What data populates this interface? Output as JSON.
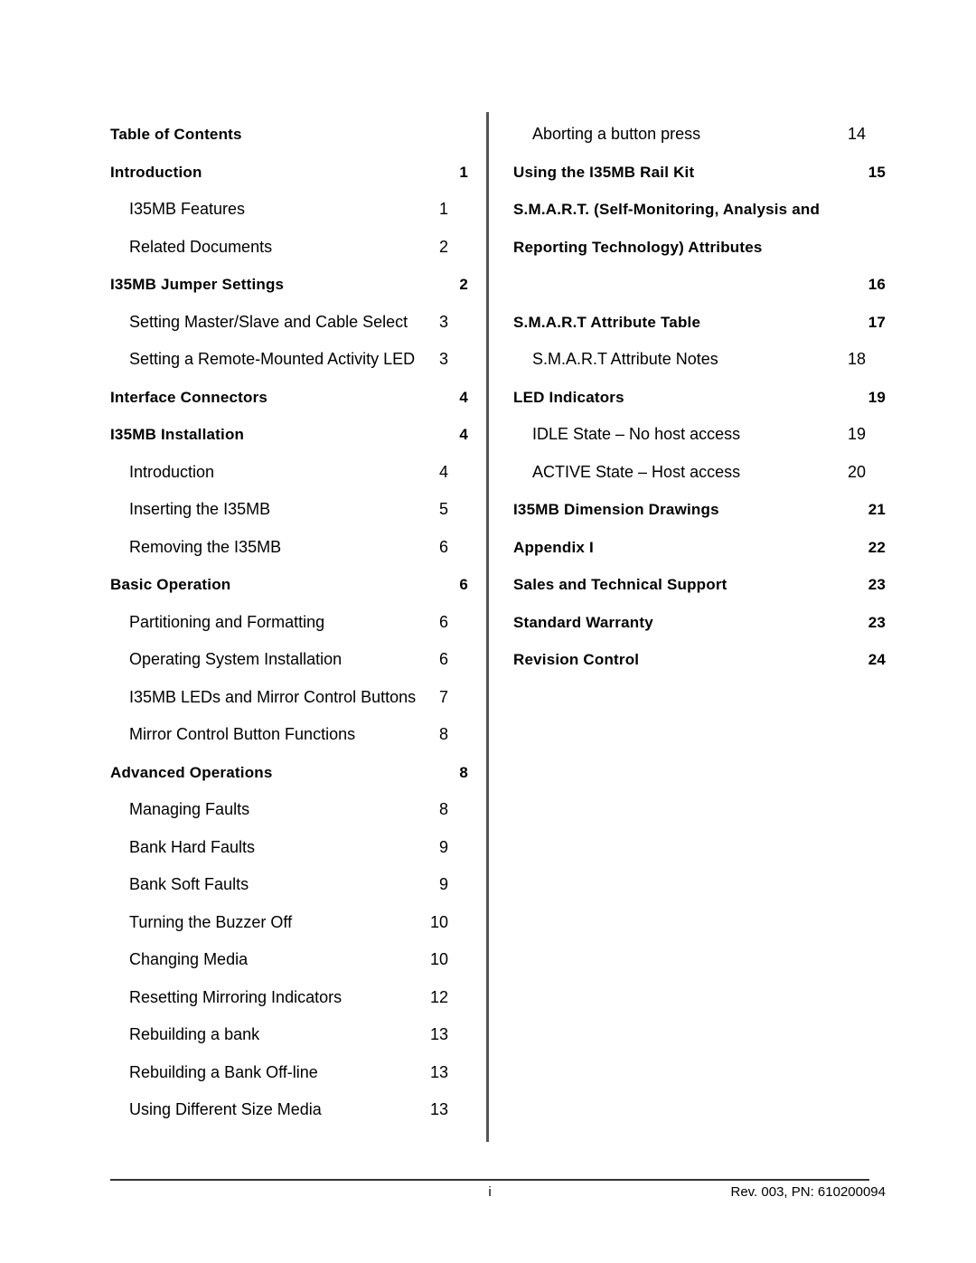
{
  "document": {
    "toc_title": "Table of Contents"
  },
  "left_column": {
    "entries": [
      {
        "label": "Introduction",
        "page": "1",
        "level": 1
      },
      {
        "label": "I35MB Features",
        "page": "1",
        "level": 2
      },
      {
        "label": "Related Documents",
        "page": "2",
        "level": 2
      },
      {
        "label": "I35MB Jumper Settings",
        "page": "2",
        "level": 1
      },
      {
        "label": "Setting Master/Slave and Cable Select",
        "page": "3",
        "level": 2
      },
      {
        "label": "Setting a Remote-Mounted Activity LED",
        "page": "3",
        "level": 2
      },
      {
        "label": "Interface Connectors",
        "page": "4",
        "level": 1
      },
      {
        "label": "I35MB Installation",
        "page": "4",
        "level": 1
      },
      {
        "label": "Introduction",
        "page": "4",
        "level": 2
      },
      {
        "label": "Inserting the I35MB",
        "page": "5",
        "level": 2
      },
      {
        "label": "Removing the I35MB",
        "page": "6",
        "level": 2
      },
      {
        "label": "Basic Operation",
        "page": "6",
        "level": 1
      },
      {
        "label": "Partitioning and Formatting",
        "page": "6",
        "level": 2
      },
      {
        "label": "Operating System Installation",
        "page": "6",
        "level": 2
      },
      {
        "label": "I35MB LEDs and Mirror Control Buttons",
        "page": "7",
        "level": 2
      },
      {
        "label": "Mirror Control Button Functions",
        "page": "8",
        "level": 2
      },
      {
        "label": "Advanced Operations",
        "page": "8",
        "level": 1
      },
      {
        "label": "Managing Faults",
        "page": "8",
        "level": 2
      },
      {
        "label": "Bank Hard Faults",
        "page": "9",
        "level": 2
      },
      {
        "label": "Bank Soft Faults",
        "page": "9",
        "level": 2
      },
      {
        "label": "Turning the Buzzer Off",
        "page": "10",
        "level": 2
      },
      {
        "label": "Changing Media",
        "page": "10",
        "level": 2
      },
      {
        "label": "Resetting Mirroring Indicators",
        "page": "12",
        "level": 2
      },
      {
        "label": "Rebuilding a bank",
        "page": "13",
        "level": 2
      },
      {
        "label": "Rebuilding a Bank Off-line",
        "page": "13",
        "level": 2
      },
      {
        "label": "Using Different Size Media",
        "page": "13",
        "level": 2
      }
    ]
  },
  "right_column": {
    "entries": [
      {
        "label": "Aborting a button press",
        "page": "14",
        "level": 2
      },
      {
        "label": "Using the I35MB Rail Kit",
        "page": "15",
        "level": 1
      },
      {
        "label": "S.M.A.R.T. (Self-Monitoring, Analysis and Reporting Technology) Attributes",
        "page": "16",
        "level": 1,
        "wrap": true
      },
      {
        "label": "S.M.A.R.T Attribute Table",
        "page": "17",
        "level": 1
      },
      {
        "label": "S.M.A.R.T Attribute Notes",
        "page": "18",
        "level": 2
      },
      {
        "label": "LED Indicators",
        "page": "19",
        "level": 1
      },
      {
        "label": "IDLE State – No host access",
        "page": "19",
        "level": 2
      },
      {
        "label": "ACTIVE State – Host access",
        "page": "20",
        "level": 2
      },
      {
        "label": "I35MB Dimension Drawings",
        "page": "21",
        "level": 1
      },
      {
        "label": "Appendix I",
        "page": "22",
        "level": 1
      },
      {
        "label": "Sales and Technical Support",
        "page": "23",
        "level": 1
      },
      {
        "label": "Standard Warranty",
        "page": "23",
        "level": 1
      },
      {
        "label": "Revision Control",
        "page": "24",
        "level": 1
      }
    ]
  },
  "footer": {
    "page_number": "i",
    "revision": "Rev. 003, PN: 610200094"
  }
}
